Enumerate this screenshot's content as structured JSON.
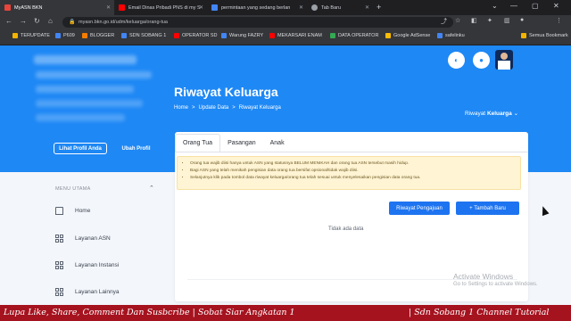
{
  "browser": {
    "tabs": [
      {
        "label": "MyASN BKN",
        "color": "#e8453c"
      },
      {
        "label": "Email Dinas Pribadi PNS di my S",
        "color": "#ff0000"
      },
      {
        "label": "permintaan yang sedang berlan",
        "color": "#4285f4"
      },
      {
        "label": "Tab Baru",
        "color": "#9aa0a6"
      }
    ],
    "url": "myasn.bkn.go.id/udm/keluarga/orang-tua",
    "bookmarks": [
      {
        "label": "TERUPDATE",
        "color": "#f4b400"
      },
      {
        "label": "P609",
        "color": "#4285f4"
      },
      {
        "label": "BLOGGER",
        "color": "#f57c00"
      },
      {
        "label": "SDN SOBANG 1",
        "color": "#4285f4"
      },
      {
        "label": "OPERATOR SD",
        "color": "#ff0000"
      },
      {
        "label": "Warung FAZRY",
        "color": "#4285f4"
      },
      {
        "label": "MEKARSARI ENAM",
        "color": "#ff0000"
      },
      {
        "label": "DATA OPERATOR",
        "color": "#34a853"
      },
      {
        "label": "Google AdSense",
        "color": "#fbbc05"
      },
      {
        "label": "safelinku",
        "color": "#4285f4"
      },
      {
        "label": "Semua Bookmark",
        "color": "#f4b400"
      }
    ]
  },
  "hero": {
    "title": "Riwayat Keluarga",
    "breadcrumb": [
      "Home",
      ">",
      "Update Data",
      ">",
      "Riwayat Keluarga"
    ],
    "user_prefix": "Riwayat",
    "user_name": "Keluarga",
    "profile_button": "Lihat Profil Anda",
    "change_profile": "Ubah Profil"
  },
  "sidebar": {
    "heading": "MENU UTAMA",
    "items": [
      {
        "label": "Home"
      },
      {
        "label": "Layanan ASN"
      },
      {
        "label": "Layanan Instansi"
      },
      {
        "label": "Layanan Lainnya"
      }
    ]
  },
  "main": {
    "tabs": [
      {
        "label": "Orang Tua",
        "active": true
      },
      {
        "label": "Pasangan",
        "active": false
      },
      {
        "label": "Anak",
        "active": false
      }
    ],
    "notices": [
      "Orang tua wajib diisi hanya untuk ASN yang statusnya BELUM MENIKAH dan orang tua ASN tersebut masih hidup.",
      "Bagi ASN yang telah menikah pengisian data orang tua bersifat opsional/tidak wajib diisi.",
      "Selanjutnya klik pada tombol data riwayat keluarga/orang tua telah sesuai untuk menyelesaikan pengisian data orang tua."
    ],
    "history_button": "Riwayat Pengajuan",
    "add_button": "+ Tambah Baru",
    "empty_text": "Tidak ada data"
  },
  "watermark": {
    "line1": "Activate Windows",
    "line2": "Go to Settings to activate Windows."
  },
  "ticker": {
    "left": "Lupa Like, Share, Comment Dan Susbcribe | Sobat Siar Angkatan 1",
    "right": "| Sdn Sobang 1 Channel Tutorial"
  }
}
